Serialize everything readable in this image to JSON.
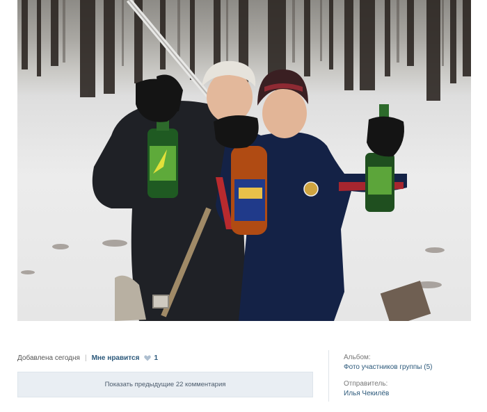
{
  "photo": {
    "icon": "photo-icon"
  },
  "footer": {
    "added_label": "Добавлена сегодня",
    "separator": "|",
    "like_label": "Мне нравится",
    "like_icon": "heart-icon",
    "like_count": "1",
    "show_prev_comments": "Показать предыдущие 22 комментария"
  },
  "sidebar": {
    "album_label": "Альбом:",
    "album_value": "Фото участников группы (5)",
    "sender_label": "Отправитель:",
    "sender_value": "Илья Чекилёв"
  },
  "colors": {
    "link": "#2b587a",
    "button_bg": "#e9eef3"
  }
}
